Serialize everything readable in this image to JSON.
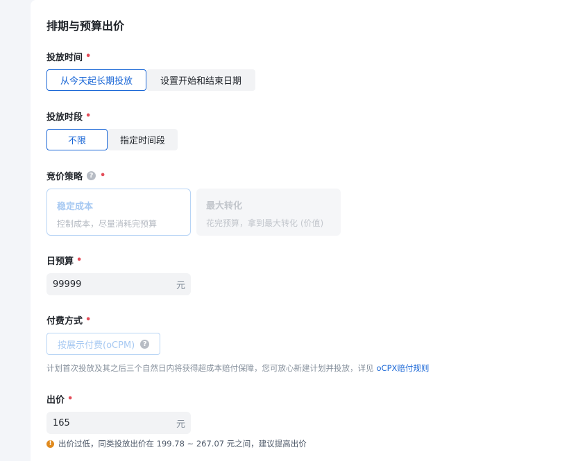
{
  "section_title": "排期与预算出价",
  "schedule": {
    "label": "投放时间",
    "options": [
      "从今天起长期投放",
      "设置开始和结束日期"
    ]
  },
  "time_period": {
    "label": "投放时段",
    "options": [
      "不限",
      "指定时间段"
    ]
  },
  "bid_strategy": {
    "label": "竞价策略",
    "help_icon": "?",
    "options": [
      {
        "title": "稳定成本",
        "desc": "控制成本，尽量消耗完预算"
      },
      {
        "title": "最大转化",
        "desc": "花完预算，拿到最大转化 (价值)"
      }
    ]
  },
  "daily_budget": {
    "label": "日预算",
    "value": "99999",
    "unit": "元"
  },
  "payment": {
    "label": "付费方式",
    "option": "按展示付费(oCPM)",
    "help_icon": "?",
    "hint": "计划首次投放及其之后三个自然日内将获得超成本赔付保障，您可放心新建计划并投放，详见",
    "hint_link": "oCPX赔付规则"
  },
  "bid": {
    "label": "出价",
    "value": "165",
    "unit": "元",
    "warn_icon": "!",
    "warning": "出价过低，同类投放出价在 199.78 ~ 267.07 元之间，建议提高出价"
  },
  "required_mark": "•"
}
